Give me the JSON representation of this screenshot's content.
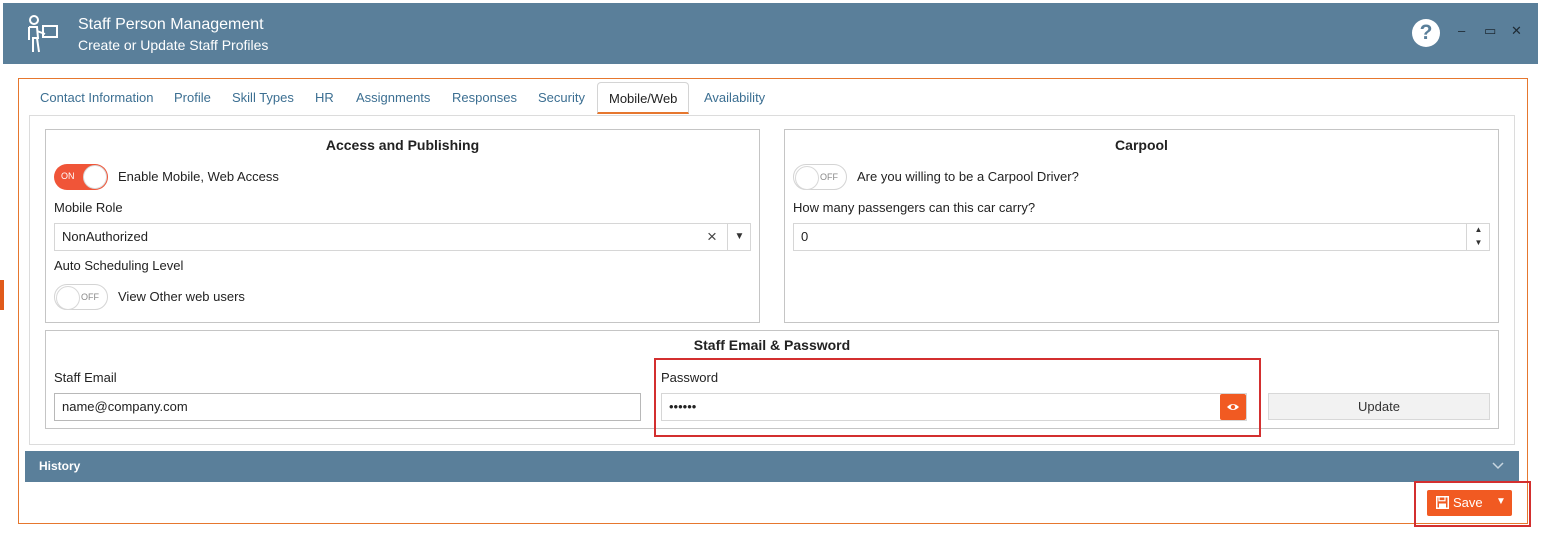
{
  "window": {
    "title": "Staff Person Management",
    "subtitle": "Create or Update Staff Profiles",
    "help_label": "?",
    "minimize_label": "–",
    "maximize_label": "▭",
    "close_label": "✕"
  },
  "tabs": [
    {
      "label": "Contact Information",
      "active": false
    },
    {
      "label": "Profile",
      "active": false
    },
    {
      "label": "Skill Types",
      "active": false
    },
    {
      "label": "HR",
      "active": false
    },
    {
      "label": "Assignments",
      "active": false
    },
    {
      "label": "Responses",
      "active": false
    },
    {
      "label": "Security",
      "active": false
    },
    {
      "label": "Mobile/Web",
      "active": true
    },
    {
      "label": "Availability",
      "active": false
    }
  ],
  "access": {
    "title": "Access and Publishing",
    "enable_toggle": {
      "state": "ON",
      "checked": true
    },
    "enable_label": "Enable Mobile, Web Access",
    "mobile_role_label": "Mobile Role",
    "mobile_role_value": "NonAuthorized",
    "clear_icon": "×",
    "dropdown_icon": "▼",
    "auto_scheduling_label": "Auto Scheduling Level",
    "view_toggle": {
      "state": "OFF",
      "checked": false
    },
    "view_label": "View Other web users"
  },
  "carpool": {
    "title": "Carpool",
    "driver_toggle": {
      "state": "OFF",
      "checked": false
    },
    "driver_label": "Are you willing to be a Carpool Driver?",
    "passengers_label": "How many passengers can this car carry?",
    "passengers_value": "0",
    "spin_up": "▲",
    "spin_down": "▼"
  },
  "credentials": {
    "title": "Staff Email & Password",
    "email_label": "Staff Email",
    "email_value": "name@company.com",
    "password_label": "Password",
    "password_value": "••••••",
    "update_label": "Update"
  },
  "history": {
    "label": "History"
  },
  "footer": {
    "save_label": "Save",
    "save_caret": "▼"
  },
  "colors": {
    "titlebar": "#5a7f9a",
    "accent": "#f15a22",
    "frame": "#e6772e",
    "highlight": "#d32f2f"
  }
}
